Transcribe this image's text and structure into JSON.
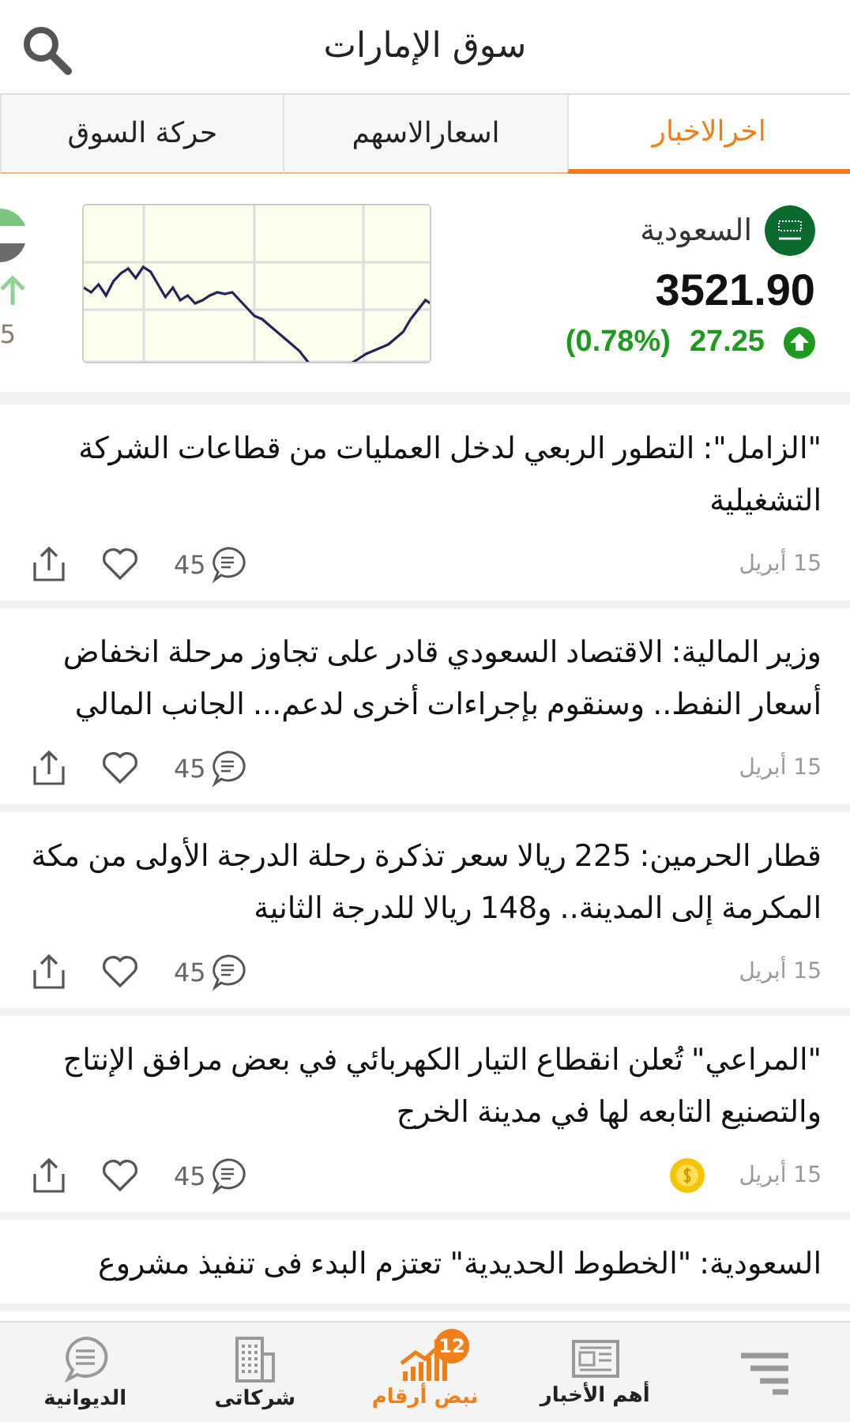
{
  "header": {
    "title": "سوق الإمارات"
  },
  "tabs": [
    {
      "label": "اخرالاخبار",
      "selected": true
    },
    {
      "label": "اسعارالاسهم",
      "selected": false
    },
    {
      "label": "حركة السوق",
      "selected": false
    }
  ],
  "market": {
    "name": "السعودية",
    "value": "3521.90",
    "change": "27.25",
    "percent": "(0.78%)",
    "next_card": {
      "value": "5"
    }
  },
  "news": [
    {
      "title": "\"الزامل\": التطور الربعي لدخل العمليات من قطاعات الشركة التشغيلية",
      "date": "15 أبريل",
      "comments": "45",
      "coin": false
    },
    {
      "title": "وزير المالية: الاقتصاد السعودي قادر على تجاوز مرحلة انخفاض أسعار النفط.. وسنقوم بإجراءات أخرى لدعم... الجانب المالي",
      "date": "15 أبريل",
      "comments": "45",
      "coin": false
    },
    {
      "title": "قطار الحرمين: 225 ريالا سعر تذكرة رحلة الدرجة الأولى من مكة المكرمة إلى المدينة.. و148 ريالا للدرجة الثانية",
      "date": "15 أبريل",
      "comments": "45",
      "coin": false
    },
    {
      "title": "\"المراعي\" تُعلن انقطاع التيار الكهربائي في بعض مرافق الإنتاج والتصنيع التابعه لها في مدينة الخرج",
      "date": "15 أبريل",
      "comments": "45",
      "coin": true
    }
  ],
  "partial_news": {
    "title": "السعودية: \"الخطوط الحديدية\" تعتزم البدء فى تنفيذ مشروع"
  },
  "bottom_nav": [
    {
      "kind": "menu",
      "selected": false
    },
    {
      "kind": "news",
      "label": "أهم الأخبار",
      "selected": false
    },
    {
      "kind": "pulse",
      "label": "نبض أرقام",
      "badge": "12",
      "selected": true
    },
    {
      "kind": "companies",
      "label": "شركاتى",
      "selected": false
    },
    {
      "kind": "chat",
      "label": "الديوانية",
      "selected": false
    }
  ]
}
